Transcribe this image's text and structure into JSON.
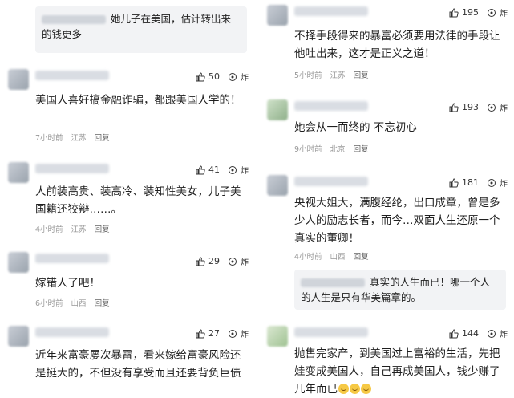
{
  "left": [
    {
      "quote": "她儿子在美国，估计转出来的钱更多",
      "text": "",
      "likes": "",
      "meta": []
    },
    {
      "text": "美国人喜好搞金融诈骗，都跟美国人学的！",
      "likes": "50",
      "action": "炸",
      "meta": [
        "7小时前",
        "江苏",
        "回复"
      ]
    },
    {
      "text": "人前装高贵、装高冷、装知性美女，儿子美国籍还狡辩……。",
      "likes": "41",
      "action": "炸",
      "meta": [
        "4小时前",
        "江苏",
        "回复"
      ]
    },
    {
      "text": "嫁错人了吧！",
      "likes": "29",
      "action": "炸",
      "meta": [
        "6小时前",
        "山西",
        "回复"
      ]
    },
    {
      "text": "近年来富豪屡次暴雷，看来嫁给富豪风险还是挺大的，不但没有享受而且还要背负巨债",
      "likes": "27",
      "action": "炸",
      "meta": []
    }
  ],
  "right": [
    {
      "text": "不择手段得来的暴富必须要用法律的手段让他吐出来，这才是正义之道！",
      "likes": "195",
      "action": "炸",
      "meta": [
        "5小时前",
        "江苏",
        "回复"
      ]
    },
    {
      "text": "她会从一而终的 不忘初心",
      "likes": "193",
      "action": "炸",
      "meta": [
        "9小时前",
        "北京",
        "回复"
      ]
    },
    {
      "text": "央视大姐大，满腹经纶，出口成章，曾是多少人的励志长者，而今…双面人生还原一个真实的董卿！",
      "likes": "181",
      "action": "炸",
      "meta": [
        "4小时前",
        "山西",
        "回复"
      ],
      "quote": "真实的人生而已！哪一个人的人生是只有华美篇章的。"
    },
    {
      "text": "抛售完家产，到美国过上富裕的生活，先把娃变成美国人，自己再成美国人，钱少赚了几年而已",
      "likes": "144",
      "action": "炸",
      "meta": [],
      "emoji_count": 3
    }
  ]
}
